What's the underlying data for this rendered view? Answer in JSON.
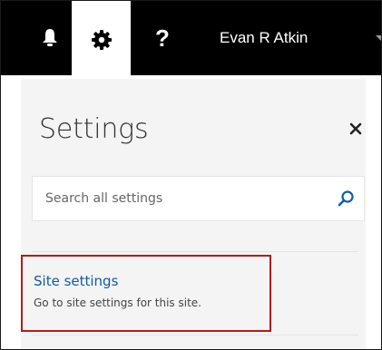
{
  "topbar": {
    "notifications_icon": "bell-icon",
    "settings_icon": "gear-icon",
    "help_label": "?",
    "user_name": "Evan R Atkin",
    "user_menu_icon": "caret-down-icon"
  },
  "settings_panel": {
    "title": "Settings",
    "close_icon": "close-icon",
    "search": {
      "placeholder": "Search all settings",
      "value": "",
      "icon": "search-icon"
    },
    "items": [
      {
        "title": "Site settings",
        "description": "Go to site settings for this site."
      }
    ]
  },
  "colors": {
    "topbar_bg": "#000000",
    "active_tab_bg": "#ffffff",
    "panel_bg": "#f4f4f4",
    "link": "#0f5ca8",
    "highlight_border": "#b31b1b"
  }
}
